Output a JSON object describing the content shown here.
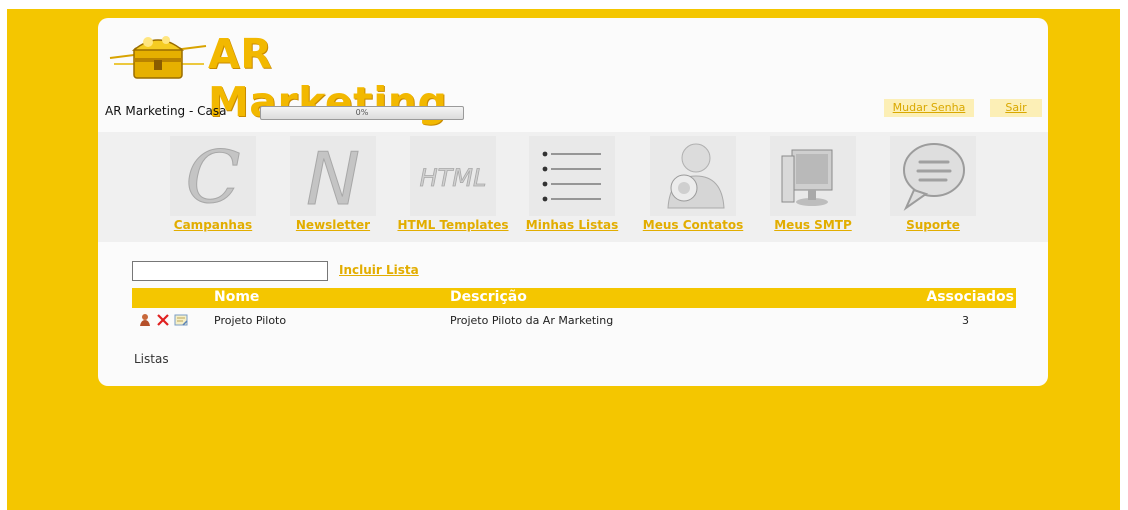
{
  "header": {
    "logo_text": "AR Marketing",
    "site_name": "AR Marketing - Casa",
    "progress_label": "0%",
    "progress_value": 0,
    "change_password_label": "Mudar Senha",
    "logout_label": "Sair"
  },
  "nav": {
    "items": [
      {
        "label": "Campanhas",
        "icon": "letter-c-icon"
      },
      {
        "label": "Newsletter",
        "icon": "letter-n-icon"
      },
      {
        "label": "HTML Templates",
        "icon": "html-icon"
      },
      {
        "label": "Minhas Listas",
        "icon": "list-icon"
      },
      {
        "label": "Meus Contatos",
        "icon": "contacts-icon"
      },
      {
        "label": "Meus SMTP",
        "icon": "computer-icon"
      },
      {
        "label": "Suporte",
        "icon": "speech-bubble-icon"
      }
    ]
  },
  "list_form": {
    "input_value": "",
    "add_label": "Incluir Lista"
  },
  "table": {
    "headers": [
      "Nome",
      "Descrição",
      "Associados"
    ],
    "rows": [
      {
        "name": "Projeto Piloto",
        "description": "Projeto Piloto da Ar Marketing",
        "associated": "3"
      }
    ]
  },
  "footer": {
    "text": "Listas"
  },
  "colors": {
    "accent": "#f4c600",
    "link": "#e2ad00",
    "panel": "#fbfbfb"
  }
}
